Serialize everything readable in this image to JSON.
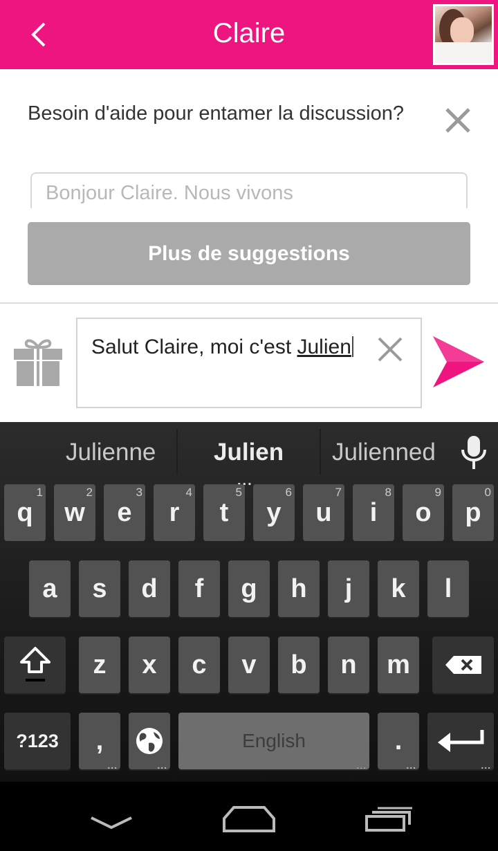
{
  "header": {
    "title": "Claire",
    "accent_color": "#ef1581"
  },
  "help": {
    "question": "Besoin d'aide pour entamer la discussion?",
    "suggestion_placeholder": "Bonjour Claire. Nous vivons",
    "more_label": "Plus de suggestions"
  },
  "composer": {
    "text_prefix": "Salut Claire, moi c'est ",
    "text_word": "Julien"
  },
  "keyboard": {
    "suggestions": [
      "Julienne",
      "Julien",
      "Julienned"
    ],
    "rows": [
      [
        {
          "k": "q",
          "h": "1"
        },
        {
          "k": "w",
          "h": "2"
        },
        {
          "k": "e",
          "h": "3"
        },
        {
          "k": "r",
          "h": "4"
        },
        {
          "k": "t",
          "h": "5"
        },
        {
          "k": "y",
          "h": "6"
        },
        {
          "k": "u",
          "h": "7"
        },
        {
          "k": "i",
          "h": "8"
        },
        {
          "k": "o",
          "h": "9"
        },
        {
          "k": "p",
          "h": "0"
        }
      ],
      [
        "a",
        "s",
        "d",
        "f",
        "g",
        "h",
        "j",
        "k",
        "l"
      ],
      [
        "z",
        "x",
        "c",
        "v",
        "b",
        "n",
        "m"
      ]
    ],
    "sym_label": "?123",
    "comma_label": ",",
    "space_label": "English",
    "period_label": "."
  }
}
